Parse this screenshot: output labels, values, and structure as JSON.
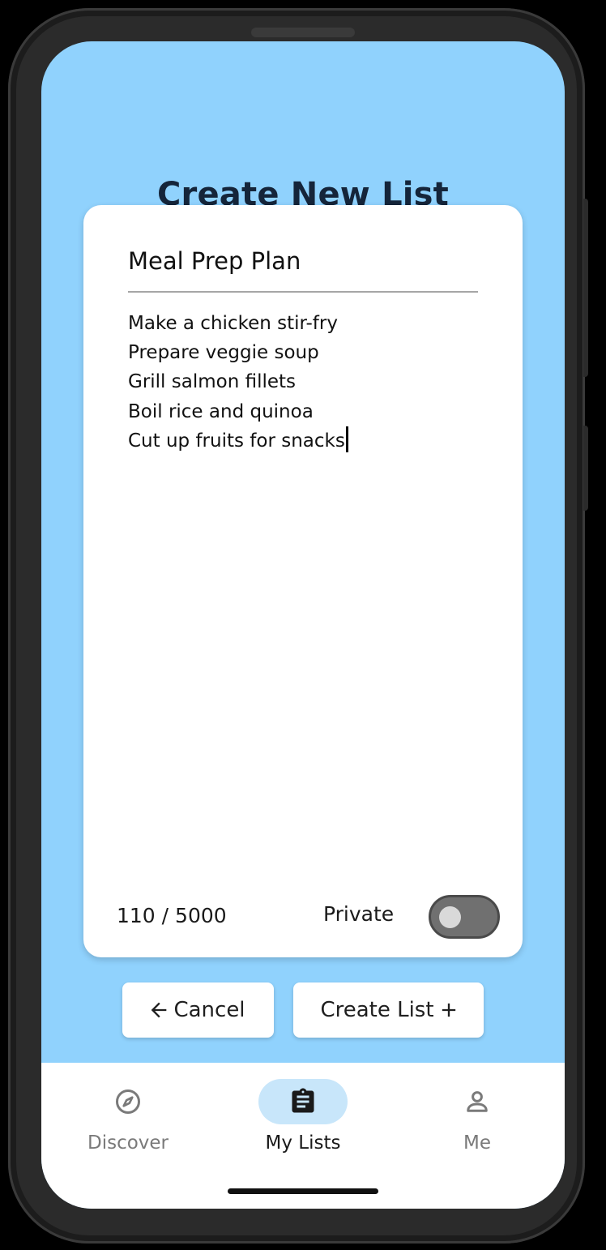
{
  "header": {
    "title": "Create New List"
  },
  "card": {
    "list_title": "Meal Prep Plan",
    "lines": [
      "Make a chicken stir-fry",
      "Prepare veggie soup",
      "Grill salmon fillets",
      "Boil rice and quinoa",
      "Cut up fruits for snacks"
    ],
    "char_count": "110 / 5000",
    "private_label": "Private",
    "private_enabled": false
  },
  "actions": {
    "cancel_label": "Cancel",
    "create_label": "Create List"
  },
  "nav": {
    "items": [
      {
        "label": "Discover",
        "icon": "compass-icon",
        "active": false
      },
      {
        "label": "My Lists",
        "icon": "clipboard-icon",
        "active": true
      },
      {
        "label": "Me",
        "icon": "person-icon",
        "active": false
      }
    ]
  },
  "colors": {
    "background": "#90d2fd",
    "active_nav_pill": "#c8e6fa",
    "title_text": "#15253a"
  }
}
